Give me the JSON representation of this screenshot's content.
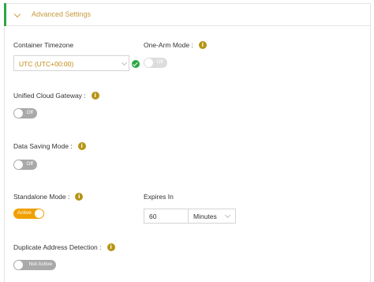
{
  "section": {
    "title": "Advanced Settings",
    "accent_color": "#2aa843",
    "title_color": "#c59a3d"
  },
  "fields": {
    "container_timezone": {
      "label": "Container Timezone",
      "value": "UTC (UTC+00:00)",
      "status_icon": "check-circle-icon"
    },
    "one_arm_mode": {
      "label": "One-Arm Mode :",
      "toggle": "Off",
      "enabled": false
    },
    "unified_cloud_gateway": {
      "label": "Unified Cloud Gateway :",
      "toggle": "Off",
      "enabled": false
    },
    "data_saving_mode": {
      "label": "Data Saving Mode :",
      "toggle": "Off",
      "enabled": false
    },
    "standalone_mode": {
      "label": "Standalone Mode :",
      "toggle": "Active",
      "enabled": true,
      "active_color": "#f0a000"
    },
    "expires_in": {
      "label": "Expires In",
      "value": "60",
      "unit": "Minutes"
    },
    "duplicate_address_detection": {
      "label": "Duplicate Address Detection :",
      "toggle": "Not Active",
      "enabled": false
    }
  },
  "icons": {
    "info": "info-icon",
    "info_glyph": "i",
    "info_color": "#b79413"
  }
}
